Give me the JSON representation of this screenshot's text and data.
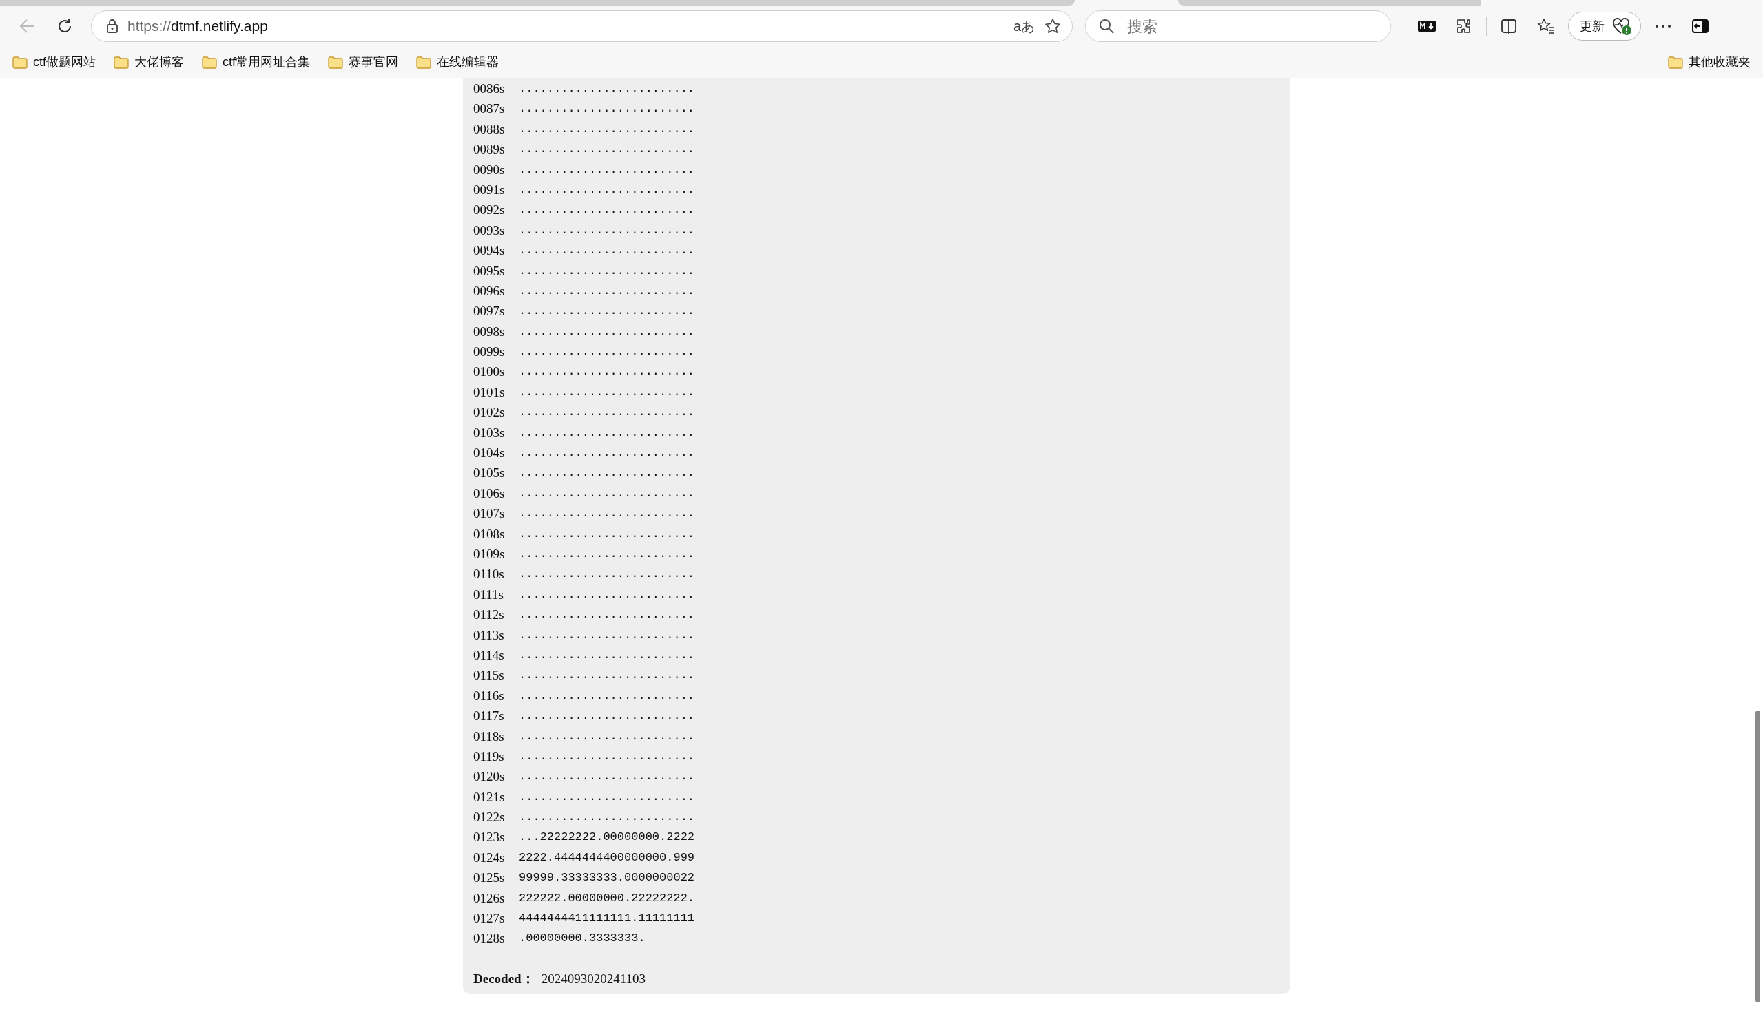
{
  "browser": {
    "address": {
      "scheme": "https://",
      "host": "dtmf.netlify.app"
    },
    "translate_glyph": "aあ",
    "search": {
      "placeholder": "搜索"
    },
    "update_button": "更新",
    "bookmarks": [
      "ctf做题网站",
      "大佬博客",
      "ctf常用网址合集",
      "赛事官网",
      "在线编辑器"
    ],
    "other_bookmarks": "其他收藏夹"
  },
  "output": {
    "lines": [
      {
        "time": "0086s",
        "signal": "........................."
      },
      {
        "time": "0087s",
        "signal": "........................."
      },
      {
        "time": "0088s",
        "signal": "........................."
      },
      {
        "time": "0089s",
        "signal": "........................."
      },
      {
        "time": "0090s",
        "signal": "........................."
      },
      {
        "time": "0091s",
        "signal": "........................."
      },
      {
        "time": "0092s",
        "signal": "........................."
      },
      {
        "time": "0093s",
        "signal": "........................."
      },
      {
        "time": "0094s",
        "signal": "........................."
      },
      {
        "time": "0095s",
        "signal": "........................."
      },
      {
        "time": "0096s",
        "signal": "........................."
      },
      {
        "time": "0097s",
        "signal": "........................."
      },
      {
        "time": "0098s",
        "signal": "........................."
      },
      {
        "time": "0099s",
        "signal": "........................."
      },
      {
        "time": "0100s",
        "signal": "........................."
      },
      {
        "time": "0101s",
        "signal": "........................."
      },
      {
        "time": "0102s",
        "signal": "........................."
      },
      {
        "time": "0103s",
        "signal": "........................."
      },
      {
        "time": "0104s",
        "signal": "........................."
      },
      {
        "time": "0105s",
        "signal": "........................."
      },
      {
        "time": "0106s",
        "signal": "........................."
      },
      {
        "time": "0107s",
        "signal": "........................."
      },
      {
        "time": "0108s",
        "signal": "........................."
      },
      {
        "time": "0109s",
        "signal": "........................."
      },
      {
        "time": "0110s",
        "signal": "........................."
      },
      {
        "time": "0111s",
        "signal": "........................."
      },
      {
        "time": "0112s",
        "signal": "........................."
      },
      {
        "time": "0113s",
        "signal": "........................."
      },
      {
        "time": "0114s",
        "signal": "........................."
      },
      {
        "time": "0115s",
        "signal": "........................."
      },
      {
        "time": "0116s",
        "signal": "........................."
      },
      {
        "time": "0117s",
        "signal": "........................."
      },
      {
        "time": "0118s",
        "signal": "........................."
      },
      {
        "time": "0119s",
        "signal": "........................."
      },
      {
        "time": "0120s",
        "signal": "........................."
      },
      {
        "time": "0121s",
        "signal": "........................."
      },
      {
        "time": "0122s",
        "signal": "........................."
      },
      {
        "time": "0123s",
        "signal": "...22222222.00000000.2222"
      },
      {
        "time": "0124s",
        "signal": "2222.4444444400000000.999"
      },
      {
        "time": "0125s",
        "signal": "99999.33333333.0000000022"
      },
      {
        "time": "0126s",
        "signal": "222222.00000000.22222222."
      },
      {
        "time": "0127s",
        "signal": "4444444411111111.11111111"
      },
      {
        "time": "0128s",
        "signal": ".00000000.3333333."
      }
    ],
    "decoded": {
      "label": "Decoded：",
      "value": "2024093020241103"
    }
  }
}
